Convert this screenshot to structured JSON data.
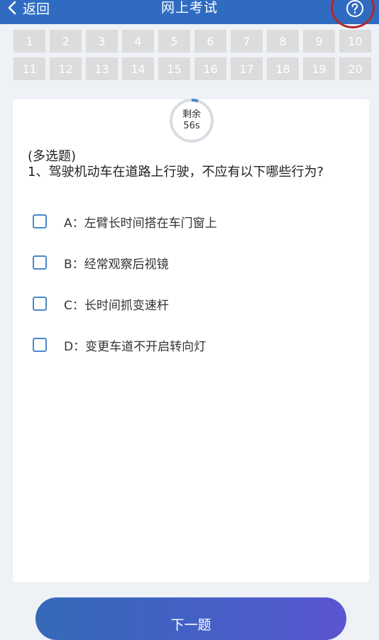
{
  "header": {
    "back_label": "返回",
    "title": "网上考试",
    "help_icon": "question-circle-icon"
  },
  "question_numbers": [
    "1",
    "2",
    "3",
    "4",
    "5",
    "6",
    "7",
    "8",
    "9",
    "10",
    "11",
    "12",
    "13",
    "14",
    "15",
    "16",
    "17",
    "18",
    "19",
    "20"
  ],
  "timer": {
    "label": "剩余",
    "value": "56s",
    "progress_fraction": 0.05
  },
  "question": {
    "type": "(多选题)",
    "text": "1、驾驶机动车在道路上行驶，不应有以下哪些行为?",
    "options": [
      {
        "label": "A：左臂长时间搭在车门窗上",
        "checked": false
      },
      {
        "label": "B：经常观察后视镜",
        "checked": false
      },
      {
        "label": "C：长时间抓变速杆",
        "checked": false
      },
      {
        "label": "D：变更车道不开启转向灯",
        "checked": false
      }
    ]
  },
  "next_button": {
    "label": "下一题"
  },
  "colors": {
    "header": "#2f6cc1",
    "number_box": "#dcdcdc",
    "checkbox_border": "#4a89c8",
    "timer_track": "#d8dde2",
    "timer_progress": "#4a89c8",
    "annotation_ring": "#b5272b"
  }
}
